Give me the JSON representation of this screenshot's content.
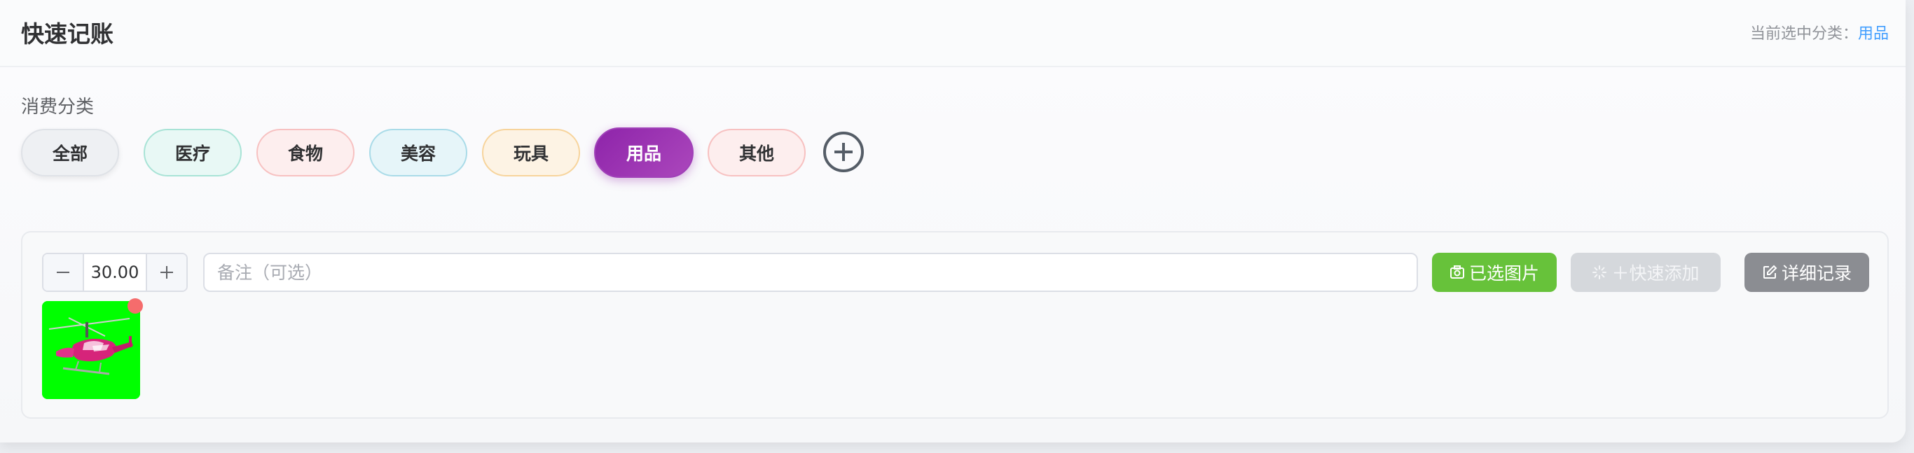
{
  "header": {
    "title": "快速记账",
    "current_label": "当前选中分类：",
    "current_value": "用品"
  },
  "categories": {
    "label": "消费分类",
    "items": [
      {
        "label": "全部"
      },
      {
        "label": "医疗"
      },
      {
        "label": "食物"
      },
      {
        "label": "美容"
      },
      {
        "label": "玩具"
      },
      {
        "label": "用品",
        "selected": true
      },
      {
        "label": "其他"
      }
    ],
    "add_icon": "plus-circle-icon"
  },
  "entry": {
    "amount": "30.00",
    "decrement_icon": "minus-icon",
    "increment_icon": "plus-icon",
    "note_placeholder": "备注（可选）",
    "note_value": "",
    "photo_button": "已选图片",
    "quick_add_button": "＋快速添加",
    "detail_button": "详细记录",
    "thumbnail_icon": "pink-helicopter-image"
  },
  "colors": {
    "accent": "#409eff",
    "selected_chip": "#8e24aa",
    "photo_button": "#67c23a",
    "quick_add_disabled": "#d5d8dc",
    "detail_button": "#8b8d92",
    "thumbnail_bg": "#00ff00"
  }
}
